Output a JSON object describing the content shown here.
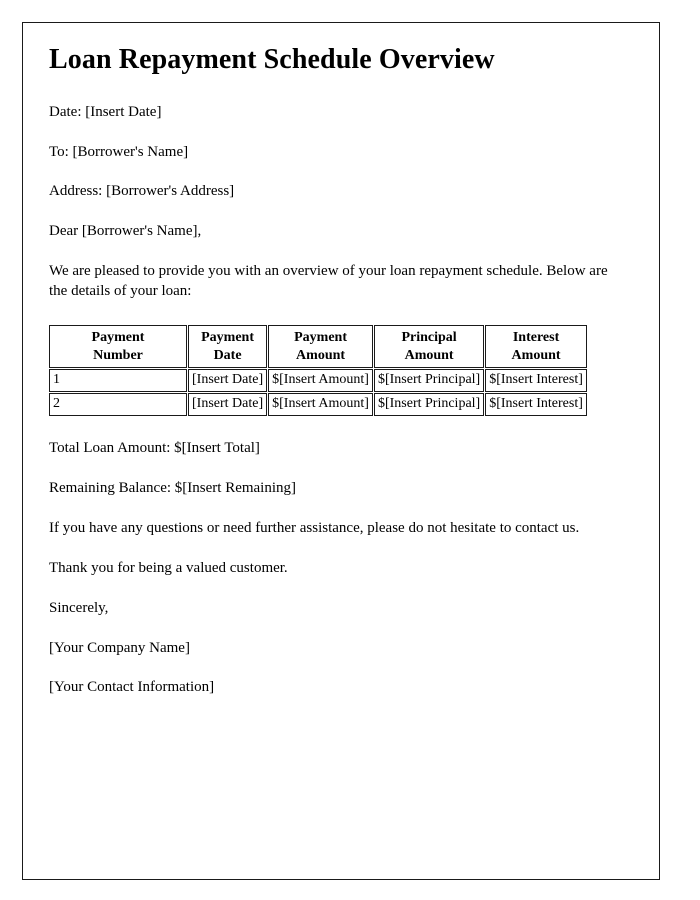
{
  "document": {
    "title": "Loan Repayment Schedule Overview",
    "fields": {
      "date_line": "Date: [Insert Date]",
      "to_line": "To: [Borrower's Name]",
      "address_line": "Address: [Borrower's Address]",
      "salutation": "Dear [Borrower's Name],"
    },
    "intro_paragraph": "We are pleased to provide you with an overview of your loan repayment schedule. Below are the details of your loan:",
    "table": {
      "columns": [
        {
          "line1": "Payment",
          "line2": "Number"
        },
        {
          "line1": "Payment",
          "line2": "Date"
        },
        {
          "line1": "Payment",
          "line2": "Amount"
        },
        {
          "line1": "Principal",
          "line2": "Amount"
        },
        {
          "line1": "Interest",
          "line2": "Amount"
        }
      ],
      "rows": [
        {
          "payment_number": "1",
          "payment_date": "[Insert Date]",
          "payment_amount": "$[Insert Amount]",
          "principal_amount": "$[Insert Principal]",
          "interest_amount": "$[Insert Interest]"
        },
        {
          "payment_number": "2",
          "payment_date": "[Insert Date]",
          "payment_amount": "$[Insert Amount]",
          "principal_amount": "$[Insert Principal]",
          "interest_amount": "$[Insert Interest]"
        }
      ]
    },
    "totals": {
      "total_loan_amount": "Total Loan Amount: $[Insert Total]",
      "remaining_balance": "Remaining Balance: $[Insert Remaining]"
    },
    "closing": {
      "assistance": "If you have any questions or need further assistance, please do not hesitate to contact us.",
      "thanks": "Thank you for being a valued customer.",
      "sign_off": "Sincerely,",
      "company_name": "[Your Company Name]",
      "contact_information": "[Your Contact Information]"
    }
  },
  "style": {
    "page_background": "#ffffff",
    "text_color": "#000000",
    "border_color": "#1a1a1a"
  }
}
